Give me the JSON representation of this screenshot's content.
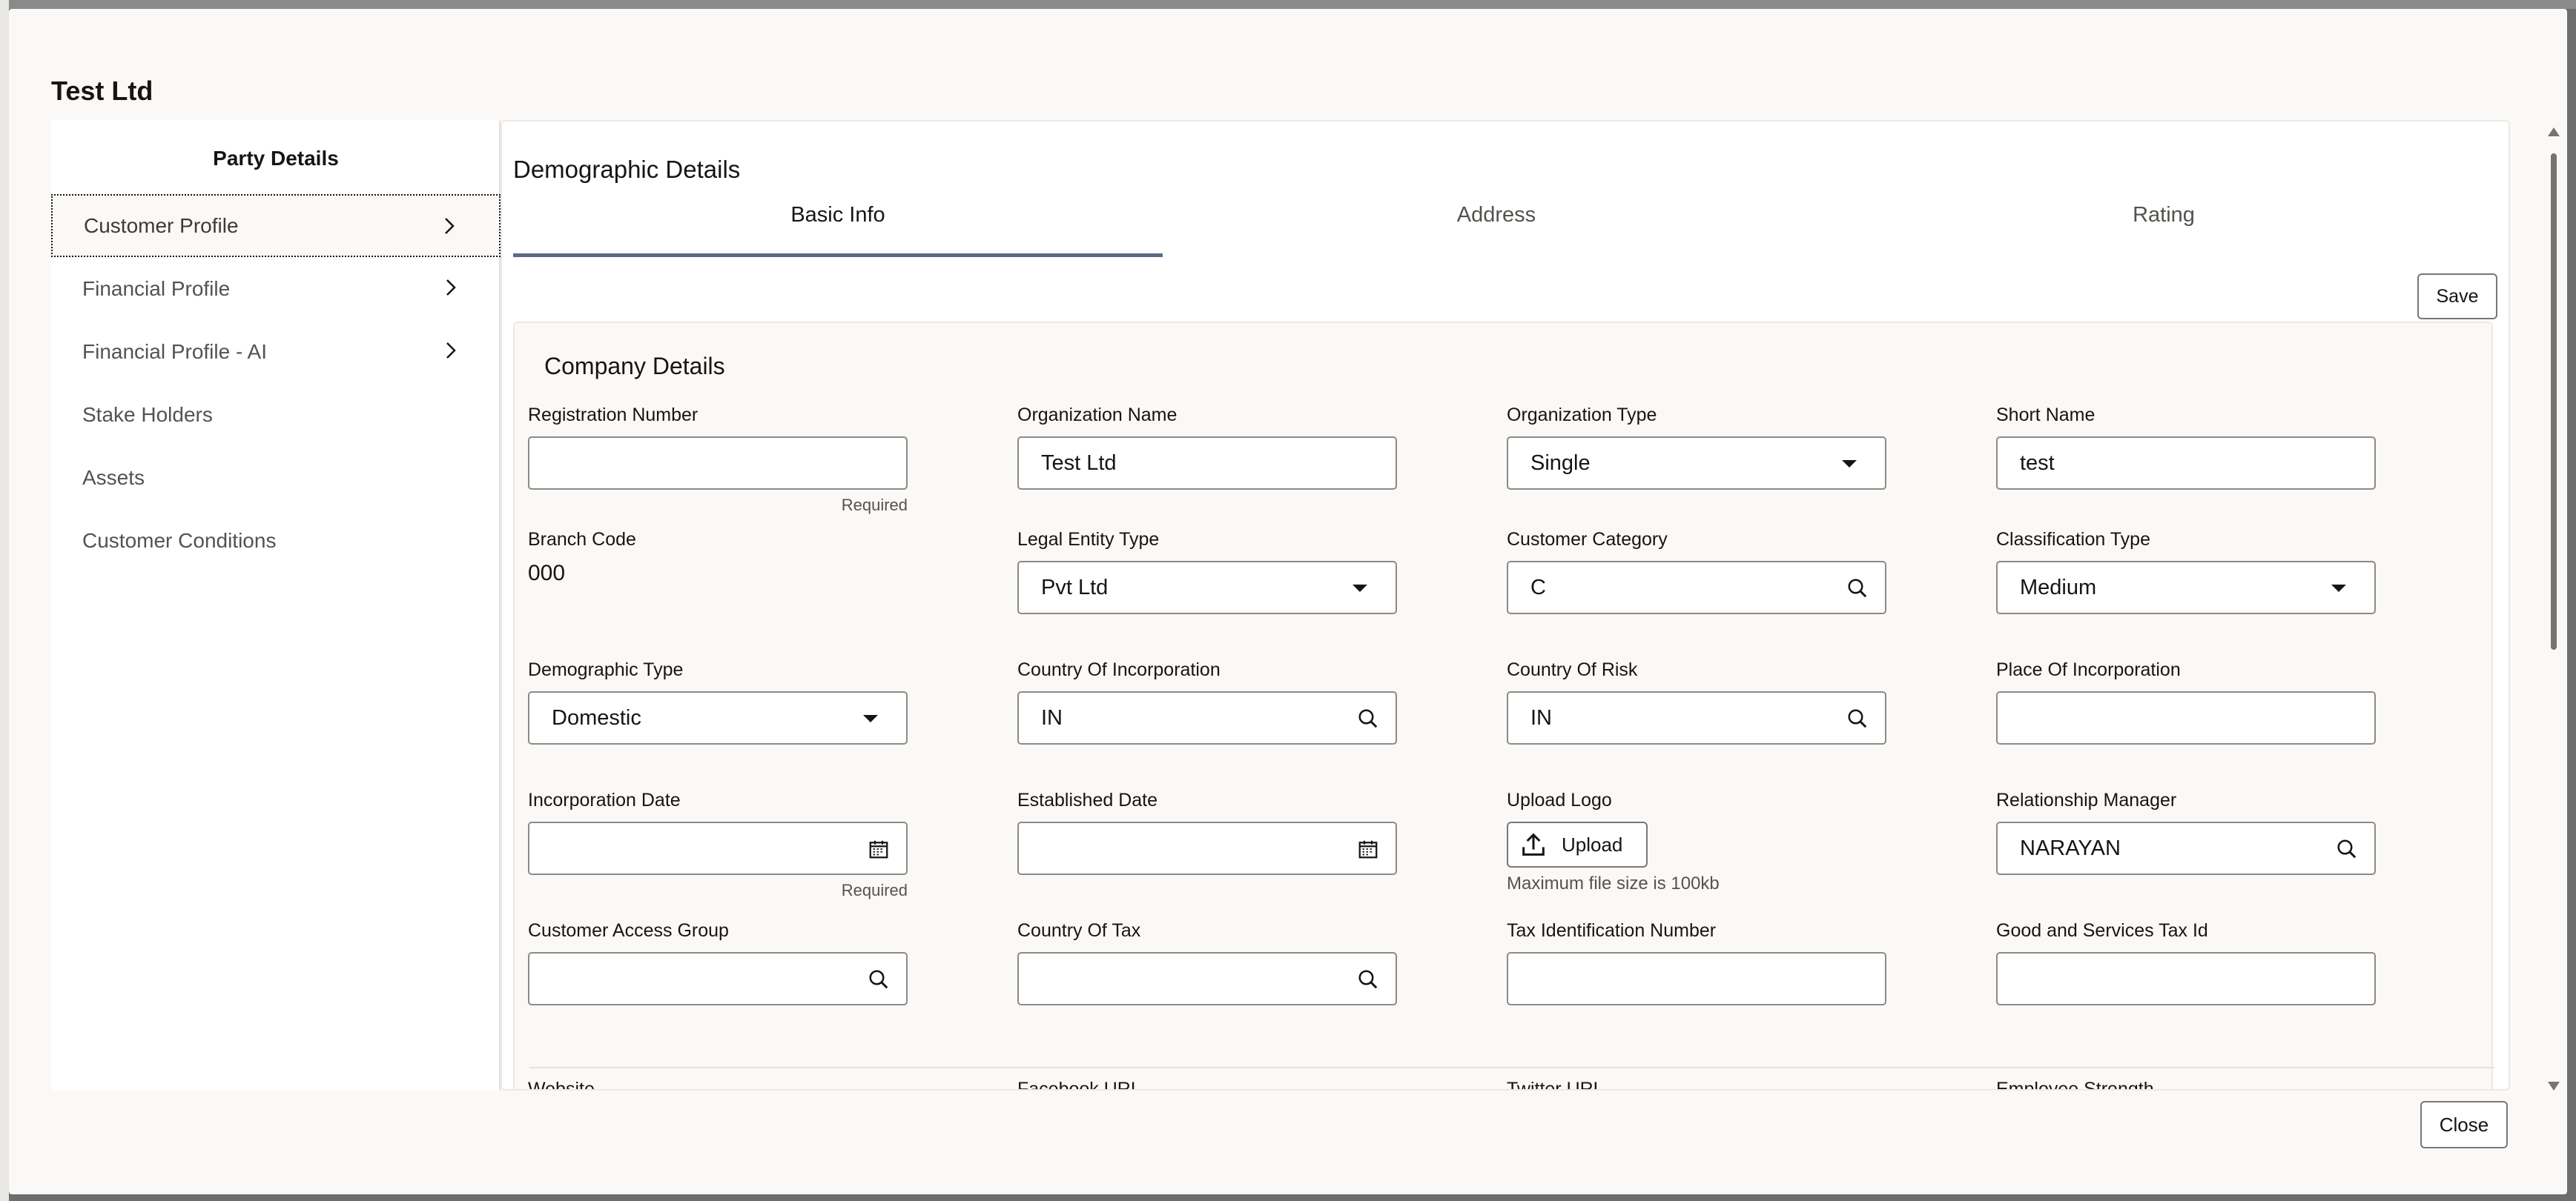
{
  "modal": {
    "title": "Test Ltd",
    "close_label": "Close"
  },
  "nav": {
    "title": "Party Details",
    "items": [
      {
        "label": "Customer Profile",
        "has_chevron": true,
        "selected": true
      },
      {
        "label": "Financial Profile",
        "has_chevron": true
      },
      {
        "label": "Financial Profile - AI",
        "has_chevron": true
      },
      {
        "label": "Stake Holders"
      },
      {
        "label": "Assets"
      },
      {
        "label": "Customer Conditions"
      }
    ]
  },
  "content": {
    "section_title": "Demographic Details",
    "tabs": [
      {
        "label": "Basic Info",
        "active": true
      },
      {
        "label": "Address"
      },
      {
        "label": "Rating"
      }
    ],
    "save_label": "Save",
    "card_title": "Company Details",
    "fields": {
      "registration_number": {
        "label": "Registration Number",
        "value": "",
        "hint": "Required"
      },
      "organization_name": {
        "label": "Organization Name",
        "value": "Test Ltd"
      },
      "organization_type": {
        "label": "Organization Type",
        "value": "Single"
      },
      "short_name": {
        "label": "Short Name",
        "value": "test"
      },
      "branch_code": {
        "label": "Branch Code",
        "value": "000"
      },
      "legal_entity_type": {
        "label": "Legal Entity Type",
        "value": "Pvt Ltd"
      },
      "customer_category": {
        "label": "Customer Category",
        "value": "C"
      },
      "classification_type": {
        "label": "Classification Type",
        "value": "Medium"
      },
      "demographic_type": {
        "label": "Demographic Type",
        "value": "Domestic"
      },
      "country_of_incorporation": {
        "label": "Country Of Incorporation",
        "value": "IN"
      },
      "country_of_risk": {
        "label": "Country Of Risk",
        "value": "IN"
      },
      "place_of_incorporation": {
        "label": "Place Of Incorporation",
        "value": ""
      },
      "incorporation_date": {
        "label": "Incorporation Date",
        "value": "",
        "hint": "Required"
      },
      "established_date": {
        "label": "Established Date",
        "value": ""
      },
      "upload_logo": {
        "label": "Upload Logo",
        "button": "Upload",
        "hint": "Maximum file size is 100kb"
      },
      "relationship_manager": {
        "label": "Relationship Manager",
        "value": "NARAYAN"
      },
      "customer_access_group": {
        "label": "Customer Access Group",
        "value": ""
      },
      "country_of_tax": {
        "label": "Country Of Tax",
        "value": ""
      },
      "tax_identification_number": {
        "label": "Tax Identification Number",
        "value": ""
      },
      "gst_id": {
        "label": "Good and Services Tax Id",
        "value": ""
      },
      "website": {
        "label": "Website"
      },
      "facebook_url": {
        "label": "Facebook URL"
      },
      "twitter_url": {
        "label": "Twitter URL"
      },
      "employee_strength": {
        "label": "Employee Strength"
      }
    }
  },
  "icons": {
    "chevron": "chevron-right-icon",
    "search": "search-icon",
    "dropdown": "caret-down-icon",
    "calendar": "calendar-icon",
    "upload": "upload-icon"
  },
  "colors": {
    "tab_underline": "#5c6b85",
    "panel_bg": "#fbf9f8",
    "text": "#161513"
  }
}
